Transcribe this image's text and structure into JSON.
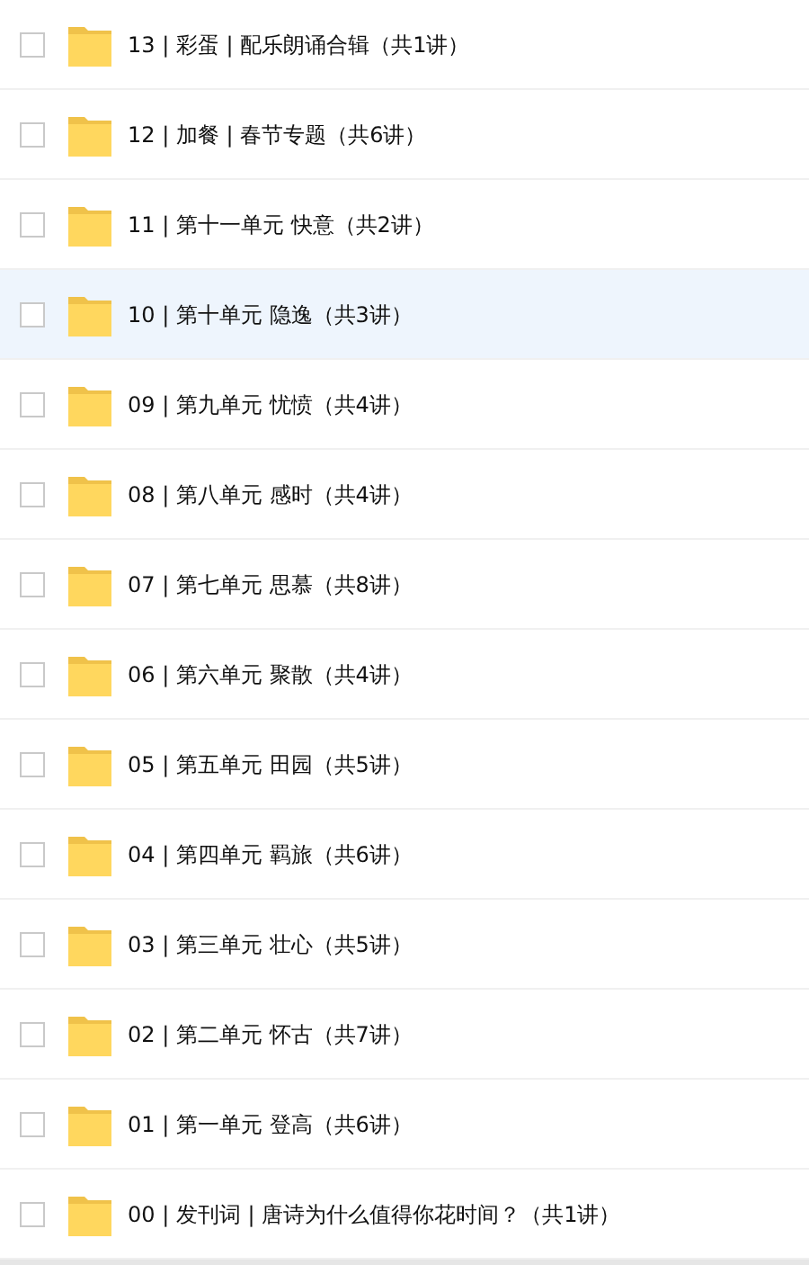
{
  "folders": [
    {
      "name": "13 | 彩蛋 | 配乐朗诵合辑（共1讲）",
      "checked": false,
      "selected": false
    },
    {
      "name": "12 | 加餐 | 春节专题（共6讲）",
      "checked": false,
      "selected": false
    },
    {
      "name": "11 | 第十一单元 快意（共2讲）",
      "checked": false,
      "selected": false
    },
    {
      "name": "10 | 第十单元 隐逸（共3讲）",
      "checked": false,
      "selected": true
    },
    {
      "name": "09 | 第九单元 忧愤（共4讲）",
      "checked": false,
      "selected": false
    },
    {
      "name": "08 | 第八单元 感时（共4讲）",
      "checked": false,
      "selected": false
    },
    {
      "name": "07 | 第七单元 思慕（共8讲）",
      "checked": false,
      "selected": false
    },
    {
      "name": "06 | 第六单元 聚散（共4讲）",
      "checked": false,
      "selected": false
    },
    {
      "name": "05 | 第五单元 田园（共5讲）",
      "checked": false,
      "selected": false
    },
    {
      "name": "04 | 第四单元 羁旅（共6讲）",
      "checked": false,
      "selected": false
    },
    {
      "name": "03 | 第三单元 壮心（共5讲）",
      "checked": false,
      "selected": false
    },
    {
      "name": "02 | 第二单元 怀古（共7讲）",
      "checked": false,
      "selected": false
    },
    {
      "name": "01 | 第一单元 登高（共6讲）",
      "checked": false,
      "selected": false
    },
    {
      "name": "00 | 发刊词 | 唐诗为什么值得你花时间？（共1讲）",
      "checked": false,
      "selected": false
    }
  ]
}
